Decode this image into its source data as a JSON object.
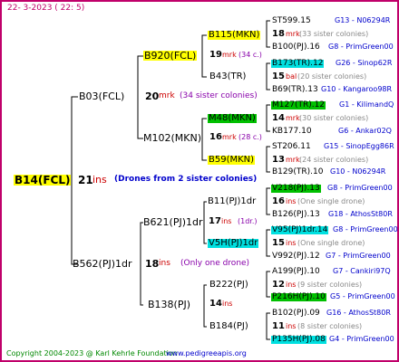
{
  "header": {
    "date": "22-  3-2023  (  22:   5)"
  },
  "root": {
    "name": "B14(FCL)",
    "num": "21",
    "unit": "ins",
    "note": "(Drones from 2 sister colonies)"
  },
  "gen1": [
    {
      "name": "B03(FCL)",
      "num": "20",
      "unit": "mrk",
      "note": "(34 sister colonies)"
    },
    {
      "name": "B562(PJ)1dr",
      "num": "18",
      "unit": "ins",
      "note": "(Only one drone)"
    }
  ],
  "gen2": [
    {
      "name": "B920(FCL)",
      "num": "19",
      "unit": "mrk",
      "note": "(34 c.)"
    },
    {
      "name": "M102(MKN)",
      "num": "16",
      "unit": "mrk",
      "note": "(28 c.)"
    },
    {
      "name": "B621(PJ)1dr",
      "num": "17",
      "unit": "ins",
      "note": "(1dr.)"
    },
    {
      "name": "B138(PJ)",
      "num": "14",
      "unit": "ins",
      "note": ""
    }
  ],
  "gen3": [
    {
      "name": "B115(MKN)"
    },
    {
      "name": "B43(TR)"
    },
    {
      "name": "M48(MKN)"
    },
    {
      "name": "B59(MKN)"
    },
    {
      "name": "B11(PJ)1dr"
    },
    {
      "name": "V5H(PJ)1dr"
    },
    {
      "name": "B222(PJ)"
    },
    {
      "name": "B184(PJ)"
    }
  ],
  "gen4": [
    {
      "sire": "ST599.15",
      "code": "G13 - N06294R",
      "num": "18",
      "unit": "mrk",
      "note": "(33 sister colonies)",
      "dam": "B100(PJ).16",
      "damcode": "G8 - PrimGreen00"
    },
    {
      "sire": "B173(TR).12",
      "code": "G26 - Sinop62R",
      "num": "15",
      "unit": "bal",
      "note": "(20 sister colonies)",
      "dam": "B69(TR).13",
      "damcode": "G10 - Kangaroo98R"
    },
    {
      "sire": "M127(TR).12",
      "code": "G1 - KilimandQ",
      "num": "14",
      "unit": "mrk",
      "note": "(30 sister colonies)",
      "dam": "KB177.10",
      "damcode": "G6 - Ankar02Q"
    },
    {
      "sire": "ST206.11",
      "code": "G15 - SinopEgg86R",
      "num": "13",
      "unit": "mrk",
      "note": "(24 sister colonies)",
      "dam": "B129(TR).10",
      "damcode": "G10 - N06294R"
    },
    {
      "sire": "V218(PJ).13",
      "code": "G8 - PrimGreen00",
      "num": "16",
      "unit": "ins",
      "note": "(One single drone)",
      "dam": "B126(PJ).13",
      "damcode": "G18 - AthosSt80R"
    },
    {
      "sire": "V95(PJ)1dr.14",
      "code": "G8 - PrimGreen00",
      "num": "15",
      "unit": "ins",
      "note": "(One single drone)",
      "dam": "V992(PJ).12",
      "damcode": "G7 - PrimGreen00"
    },
    {
      "sire": "A199(PJ).10",
      "code": "G7 - Cankiri97Q",
      "num": "12",
      "unit": "ins",
      "note": "(9 sister colonies)",
      "dam": "P216H(PJ).10",
      "damcode": "G5 - PrimGreen00"
    },
    {
      "sire": "B102(PJ).09",
      "code": "G16 - AthosSt80R",
      "num": "11",
      "unit": "ins",
      "note": "(8 sister colonies)",
      "dam": "P135H(PJ).08",
      "damcode": "G4 - PrimGreen00"
    }
  ],
  "footer": {
    "copyright": "Copyright 2004-2023 @ Karl Kehrle Foundation",
    "site": "www.pedigreeapis.org"
  }
}
